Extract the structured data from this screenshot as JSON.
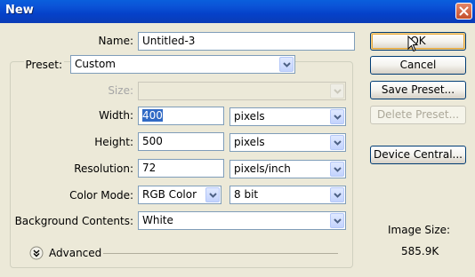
{
  "window": {
    "title": "New"
  },
  "form": {
    "name_label": "Name:",
    "name_value": "Untitled-3",
    "preset_label": "Preset:",
    "preset_value": "Custom",
    "size_label": "Size:",
    "size_value": "",
    "width_label": "Width:",
    "width_value": "400",
    "width_unit": "pixels",
    "height_label": "Height:",
    "height_value": "500",
    "height_unit": "pixels",
    "resolution_label": "Resolution:",
    "resolution_value": "72",
    "resolution_unit": "pixels/inch",
    "color_mode_label": "Color Mode:",
    "color_mode_value": "RGB Color",
    "bit_depth_value": "8 bit",
    "background_label": "Background Contents:",
    "background_value": "White",
    "advanced_label": "Advanced"
  },
  "buttons": {
    "ok": "OK",
    "cancel": "Cancel",
    "save_preset": "Save Preset...",
    "delete_preset": "Delete Preset...",
    "device_central": "Device Central..."
  },
  "info": {
    "image_size_label": "Image Size:",
    "image_size_value": "585.9K"
  },
  "colors": {
    "titlebar": "#0a54d8",
    "dialog_bg": "#ece9d8",
    "selection": "#316ac5",
    "close_button": "#c44f2b"
  }
}
